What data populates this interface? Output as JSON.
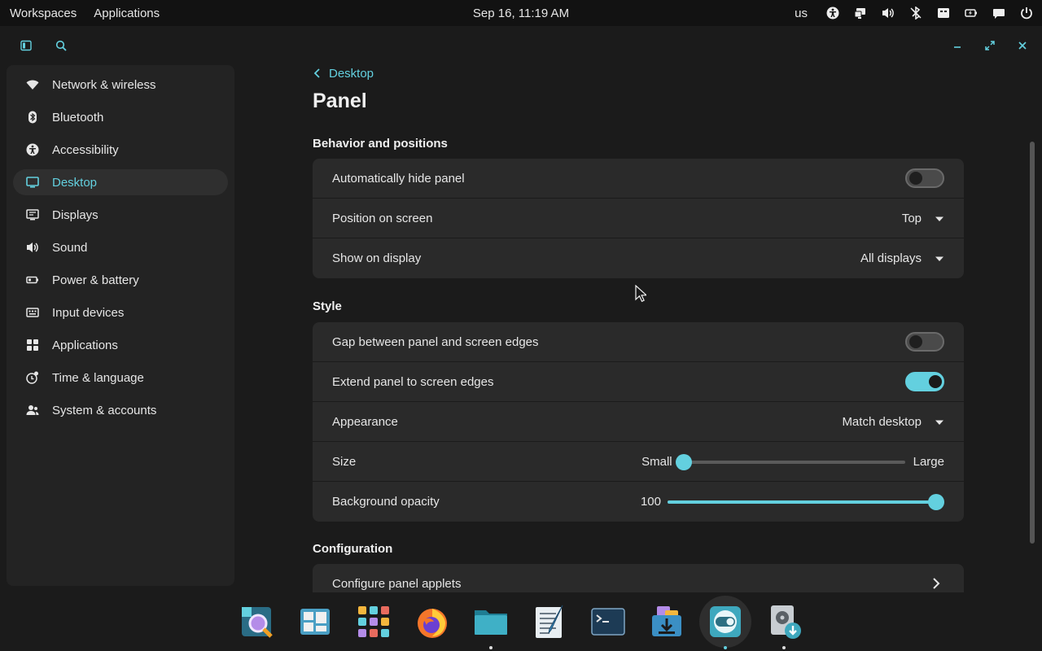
{
  "topbar": {
    "workspaces": "Workspaces",
    "applications": "Applications",
    "clock": "Sep 16, 11:19 AM",
    "keyboard_layout": "us"
  },
  "tray_icons": [
    "accessibility-icon",
    "network-icon",
    "volume-icon",
    "bluetooth-icon",
    "notifications-icon",
    "battery-icon",
    "chat-icon",
    "power-icon"
  ],
  "sidebar": {
    "items": [
      {
        "label": "Network & wireless",
        "icon": "wifi-icon"
      },
      {
        "label": "Bluetooth",
        "icon": "bluetooth-icon"
      },
      {
        "label": "Accessibility",
        "icon": "accessibility-icon"
      },
      {
        "label": "Desktop",
        "icon": "desktop-icon",
        "active": true
      },
      {
        "label": "Displays",
        "icon": "displays-icon"
      },
      {
        "label": "Sound",
        "icon": "sound-icon"
      },
      {
        "label": "Power & battery",
        "icon": "battery-icon"
      },
      {
        "label": "Input devices",
        "icon": "keyboard-icon"
      },
      {
        "label": "Applications",
        "icon": "apps-grid-icon"
      },
      {
        "label": "Time & language",
        "icon": "time-language-icon"
      },
      {
        "label": "System & accounts",
        "icon": "accounts-icon"
      }
    ]
  },
  "main": {
    "breadcrumb": "Desktop",
    "title": "Panel",
    "sections": {
      "behavior": {
        "title": "Behavior and positions",
        "auto_hide": {
          "label": "Automatically hide panel",
          "value": false
        },
        "position": {
          "label": "Position on screen",
          "value": "Top"
        },
        "show_on": {
          "label": "Show on display",
          "value": "All displays"
        }
      },
      "style": {
        "title": "Style",
        "gap": {
          "label": "Gap between panel and screen edges",
          "value": false
        },
        "extend": {
          "label": "Extend panel to screen edges",
          "value": true
        },
        "appearance": {
          "label": "Appearance",
          "value": "Match desktop"
        },
        "size": {
          "label": "Size",
          "min_label": "Small",
          "max_label": "Large",
          "value": 0.0
        },
        "opacity": {
          "label": "Background opacity",
          "value_text": "100",
          "value": 1.0
        }
      },
      "configuration": {
        "title": "Configuration",
        "applets": {
          "label": "Configure panel applets"
        }
      }
    }
  },
  "colors": {
    "accent": "#63d0df",
    "background": "#1b1b1b",
    "card": "#2a2a2a",
    "sidebar": "#232323"
  },
  "dock": [
    "launcher-icon",
    "workspaces-icon",
    "app-library-icon",
    "firefox-icon",
    "files-icon",
    "text-editor-icon",
    "terminal-icon",
    "store-icon",
    "settings-icon",
    "disk-installer-icon"
  ]
}
